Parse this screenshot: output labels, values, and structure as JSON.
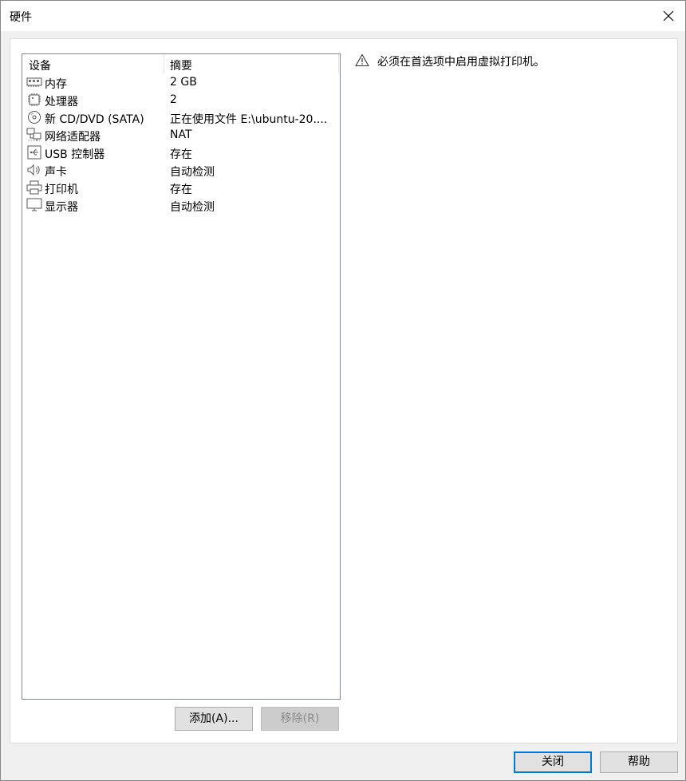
{
  "window": {
    "title": "硬件"
  },
  "list": {
    "headers": {
      "device": "设备",
      "summary": "摘要"
    },
    "rows": [
      {
        "name": "内存",
        "summary": "2 GB",
        "icon": "memory-icon"
      },
      {
        "name": "处理器",
        "summary": "2",
        "icon": "cpu-icon"
      },
      {
        "name": "新 CD/DVD (SATA)",
        "summary": "正在使用文件 E:\\ubuntu-20....",
        "icon": "cd-icon"
      },
      {
        "name": "网络适配器",
        "summary": "NAT",
        "icon": "network-icon"
      },
      {
        "name": "USB 控制器",
        "summary": "存在",
        "icon": "usb-icon"
      },
      {
        "name": "声卡",
        "summary": "自动检测",
        "icon": "speaker-icon"
      },
      {
        "name": "打印机",
        "summary": "存在",
        "icon": "printer-icon"
      },
      {
        "name": "显示器",
        "summary": "自动检测",
        "icon": "monitor-icon"
      }
    ]
  },
  "buttons": {
    "add": "添加(A)...",
    "remove": "移除(R)",
    "close": "关闭",
    "help": "帮助"
  },
  "warning": {
    "text": "必须在首选项中启用虚拟打印机。",
    "icon": "warning-icon"
  }
}
